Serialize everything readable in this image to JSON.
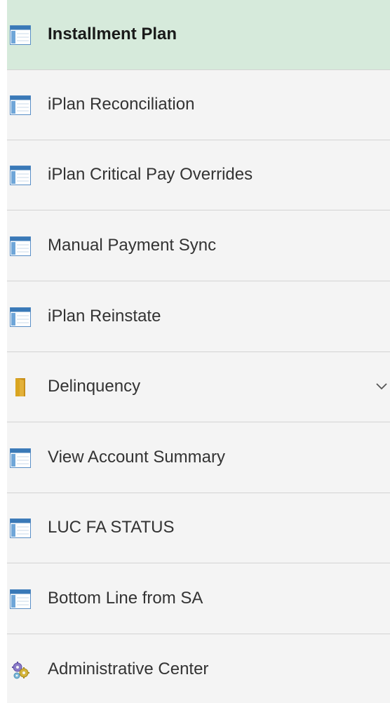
{
  "nav": {
    "items": [
      {
        "label": "Installment Plan",
        "icon": "component-page-icon",
        "selected": true
      },
      {
        "label": "iPlan Reconciliation",
        "icon": "component-page-icon"
      },
      {
        "label": "iPlan Critical Pay Overrides",
        "icon": "component-page-icon"
      },
      {
        "label": "Manual Payment Sync",
        "icon": "component-page-icon"
      },
      {
        "label": "iPlan Reinstate",
        "icon": "component-page-icon"
      },
      {
        "label": "Delinquency",
        "icon": "folder-icon",
        "expandable": true,
        "expand_icon": "chevron-down-icon"
      },
      {
        "label": "View Account Summary",
        "icon": "component-page-icon"
      },
      {
        "label": "LUC FA STATUS",
        "icon": "component-page-icon"
      },
      {
        "label": "Bottom Line from SA",
        "icon": "component-page-icon"
      },
      {
        "label": "Administrative Center",
        "icon": "gear-cluster-icon"
      }
    ]
  },
  "colors": {
    "selected_background": "#d6eadb",
    "item_background": "#f4f4f4",
    "divider": "#d3d3d3",
    "page_icon_blue": "#3a79b7",
    "folder_gold": "#d9a520"
  }
}
